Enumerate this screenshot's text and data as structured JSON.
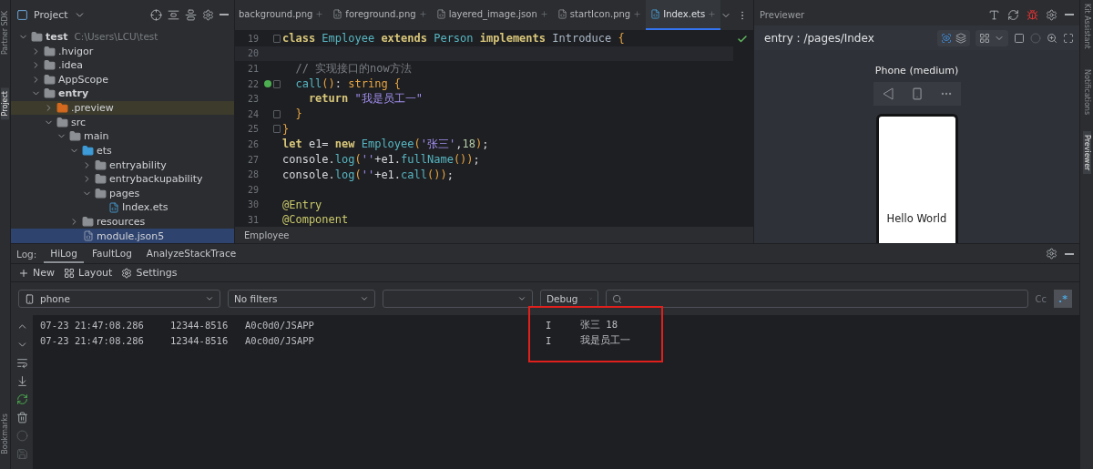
{
  "left_strip": [
    {
      "label": "Partner SDK"
    },
    {
      "label": "Project",
      "selected": true
    },
    {
      "label": "Bookmarks",
      "selected": false
    }
  ],
  "project_panel": {
    "title": "Project",
    "tree": [
      {
        "name": "test",
        "hint": "C:\\Users\\LCU\\test",
        "kind": "module",
        "expanded": true,
        "selected": false,
        "children": [
          {
            "name": ".hvigor",
            "kind": "folder",
            "expanded": false,
            "selected": false
          },
          {
            "name": ".idea",
            "kind": "folder",
            "expanded": false,
            "selected": false
          },
          {
            "name": "AppScope",
            "kind": "folder",
            "expanded": false,
            "selected": false
          },
          {
            "name": "entry",
            "kind": "module",
            "expanded": true,
            "selected": false,
            "children": [
              {
                "name": ".preview",
                "kind": "folder-excluded",
                "expanded": false,
                "selected": false
              },
              {
                "name": "src",
                "kind": "folder",
                "expanded": true,
                "selected": false,
                "children": [
                  {
                    "name": "main",
                    "kind": "folder",
                    "expanded": true,
                    "selected": false,
                    "children": [
                      {
                        "name": "ets",
                        "kind": "folder-source",
                        "expanded": true,
                        "selected": false,
                        "children": [
                          {
                            "name": "entryability",
                            "kind": "folder",
                            "expanded": false,
                            "selected": false
                          },
                          {
                            "name": "entrybackupability",
                            "kind": "folder",
                            "expanded": false,
                            "selected": false
                          },
                          {
                            "name": "pages",
                            "kind": "folder",
                            "expanded": true,
                            "selected": false,
                            "children": [
                              {
                                "name": "Index.ets",
                                "kind": "file-ets",
                                "selected": false
                              }
                            ]
                          }
                        ]
                      },
                      {
                        "name": "resources",
                        "kind": "folder",
                        "expanded": false,
                        "selected": false
                      },
                      {
                        "name": "module.json5",
                        "kind": "file-json",
                        "selected": true
                      }
                    ]
                  }
                ]
              }
            ]
          }
        ]
      }
    ]
  },
  "editor": {
    "tabs": [
      {
        "label": "background.png",
        "selected": false
      },
      {
        "label": "foreground.png",
        "selected": false
      },
      {
        "label": "layered_image.json",
        "selected": false
      },
      {
        "label": "startIcon.png",
        "selected": false
      },
      {
        "label": "Index.ets",
        "selected": true
      }
    ],
    "lines": [
      {
        "number": "19",
        "current": false,
        "fold": true,
        "override": false,
        "tokens": [
          {
            "text": "class ",
            "kind": "kw"
          },
          {
            "text": "Employee ",
            "kind": "type"
          },
          {
            "text": "extends ",
            "kind": "kw"
          },
          {
            "text": "Person ",
            "kind": "type"
          },
          {
            "text": "implements ",
            "kind": "kw"
          },
          {
            "text": "Introduce ",
            "kind": "iface"
          },
          {
            "text": "{",
            "kind": "brace"
          }
        ]
      },
      {
        "number": "20",
        "current": true,
        "fold": false,
        "override": false
      },
      {
        "number": "21",
        "current": false,
        "fold": false,
        "override": false,
        "tokens": [
          {
            "text": "  // 实现接口的now方法",
            "kind": "comment"
          }
        ]
      },
      {
        "number": "22",
        "current": false,
        "fold": true,
        "override": true,
        "tokens": [
          {
            "text": "  call",
            "kind": "fn"
          },
          {
            "text": "()",
            "kind": "brace"
          },
          {
            "text": ": ",
            "kind": "plain"
          },
          {
            "text": "string",
            "kind": "typekw"
          },
          {
            "text": " {",
            "kind": "brace"
          }
        ]
      },
      {
        "number": "23",
        "current": false,
        "fold": false,
        "override": false,
        "tokens": [
          {
            "text": "    return ",
            "kind": "kw"
          },
          {
            "text": "\"我是员工一\"",
            "kind": "string"
          }
        ]
      },
      {
        "number": "24",
        "current": false,
        "fold": true,
        "override": false,
        "tokens": [
          {
            "text": "  }",
            "kind": "brace"
          }
        ]
      },
      {
        "number": "25",
        "current": false,
        "fold": true,
        "override": false,
        "tokens": [
          {
            "text": "}",
            "kind": "brace"
          }
        ]
      },
      {
        "number": "26",
        "current": false,
        "fold": false,
        "override": false,
        "tokens": [
          {
            "text": "let",
            "kind": "kw"
          },
          {
            "text": " e1= ",
            "kind": "plain"
          },
          {
            "text": "new ",
            "kind": "kw"
          },
          {
            "text": "Employee",
            "kind": "type"
          },
          {
            "text": "(",
            "kind": "brace"
          },
          {
            "text": "'张三'",
            "kind": "string"
          },
          {
            "text": ",",
            "kind": "plain"
          },
          {
            "text": "18",
            "kind": "number"
          },
          {
            "text": ")",
            "kind": "brace"
          },
          {
            "text": ";",
            "kind": "plain"
          }
        ]
      },
      {
        "number": "27",
        "current": false,
        "fold": false,
        "override": false,
        "tokens": [
          {
            "text": "console.",
            "kind": "plain"
          },
          {
            "text": "log",
            "kind": "fn"
          },
          {
            "text": "(",
            "kind": "brace"
          },
          {
            "text": "''",
            "kind": "string"
          },
          {
            "text": "+e1.",
            "kind": "plain"
          },
          {
            "text": "fullName",
            "kind": "fn"
          },
          {
            "text": "())",
            "kind": "brace"
          },
          {
            "text": ";",
            "kind": "plain"
          }
        ]
      },
      {
        "number": "28",
        "current": false,
        "fold": false,
        "override": false,
        "tokens": [
          {
            "text": "console.",
            "kind": "plain"
          },
          {
            "text": "log",
            "kind": "fn"
          },
          {
            "text": "(",
            "kind": "brace"
          },
          {
            "text": "''",
            "kind": "string"
          },
          {
            "text": "+e1.",
            "kind": "plain"
          },
          {
            "text": "call",
            "kind": "fn"
          },
          {
            "text": "())",
            "kind": "brace"
          },
          {
            "text": ";",
            "kind": "plain"
          }
        ]
      },
      {
        "number": "29",
        "current": false,
        "fold": false,
        "override": false
      },
      {
        "number": "30",
        "current": false,
        "fold": false,
        "override": false,
        "tokens": [
          {
            "text": "@Entry",
            "kind": "annotation"
          }
        ]
      },
      {
        "number": "31",
        "current": false,
        "fold": false,
        "override": false,
        "tokens": [
          {
            "text": "@Component",
            "kind": "annotation"
          }
        ]
      }
    ],
    "breadcrumb": "Employee"
  },
  "previewer": {
    "title": "Previewer",
    "route": "entry : /pages/Index",
    "device": "Phone (medium)",
    "screen_text": "Hello World"
  },
  "right_strip": [
    {
      "label": "Kit Assistant"
    },
    {
      "label": "Notifications"
    },
    {
      "label": "Previewer",
      "selected": true
    }
  ],
  "log": {
    "label": "Log:",
    "tabs": [
      {
        "label": "HiLog",
        "selected": true
      },
      {
        "label": "FaultLog",
        "selected": false
      },
      {
        "label": "AnalyzeStackTrace",
        "selected": false
      }
    ],
    "actions": [
      {
        "label": "New",
        "kind": "new"
      },
      {
        "label": "Layout",
        "kind": "layout"
      },
      {
        "label": "Settings",
        "kind": "settings"
      }
    ],
    "device": "phone",
    "filter": "No filters",
    "level": "Debug",
    "case_label": "Cc",
    "regex": {
      "label": ".*",
      "on": true
    },
    "rows": [
      {
        "time": "07-23 21:47:08.286",
        "pid": "12344-8516",
        "tag": "A0c0d0/JSAPP",
        "level": "I",
        "message": "张三 18"
      },
      {
        "time": "07-23 21:47:08.286",
        "pid": "12344-8516",
        "tag": "A0c0d0/JSAPP",
        "level": "I",
        "message": "我是员工一"
      }
    ],
    "red_frame": true
  }
}
